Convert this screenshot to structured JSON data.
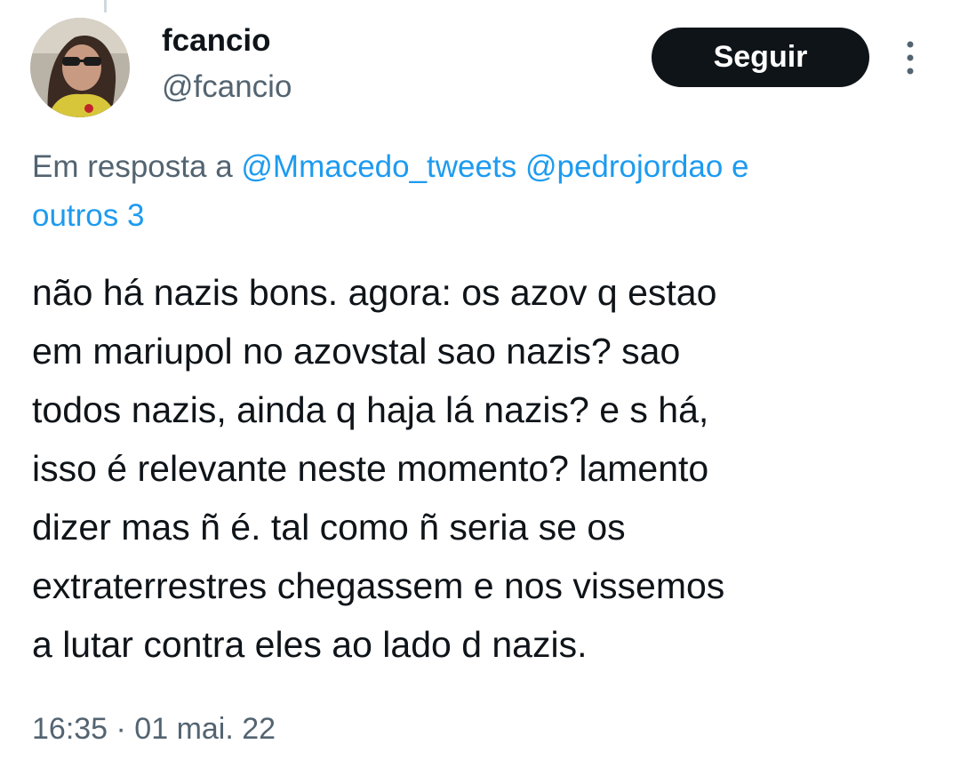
{
  "tweet": {
    "author": {
      "display_name": "fcancio",
      "handle": "@fcancio",
      "avatar_icon": "profile-photo"
    },
    "follow_label": "Seguir",
    "more_icon": "more-vertical-icon",
    "reply_context": {
      "prefix": "Em resposta a",
      "mention_1": "@Mmacedo_tweets",
      "mention_2": "@pedrojordao",
      "joiner": "e",
      "others": "outros 3"
    },
    "text_lines": [
      "não há nazis bons. agora: os azov q estao",
      "em mariupol no azovstal sao nazis? sao",
      "todos nazis, ainda q haja lá nazis? e s há,",
      "isso é relevante neste momento? lamento",
      "dizer mas ñ é. tal como ñ seria se os",
      "extraterrestres chegassem e nos vissemos",
      "a lutar contra eles ao lado d nazis."
    ],
    "timestamp": "16:35 · 01 mai. 22"
  },
  "colors": {
    "text_primary": "#0f1419",
    "text_secondary": "#536471",
    "link": "#1d9bf0",
    "button_bg": "#0f1419",
    "button_text": "#ffffff"
  }
}
